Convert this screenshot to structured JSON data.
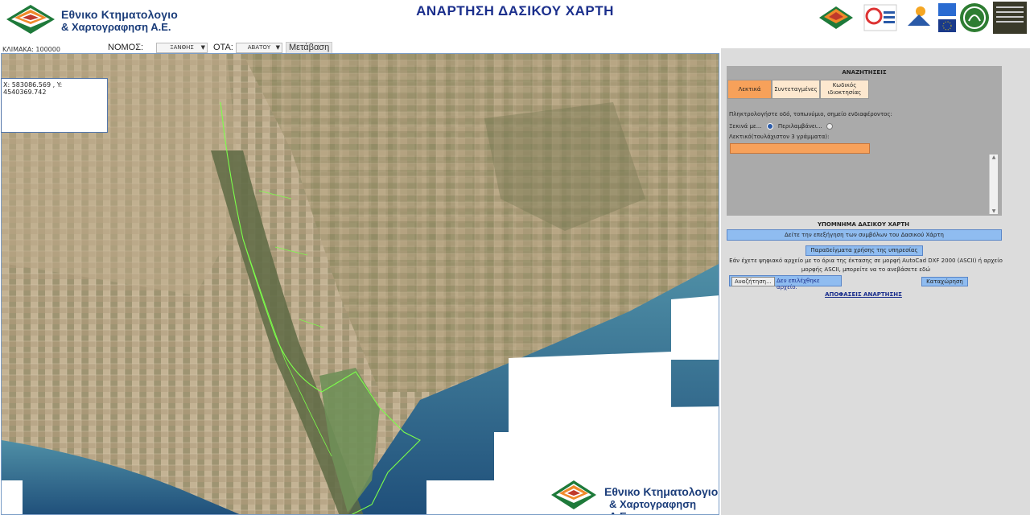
{
  "header": {
    "title": "ΑΝΑΡΤΗΣΗ ΔΑΣΙΚΟΥ ΧΑΡΤΗ",
    "org_line1": "Εθνικο Κτηματολογιο",
    "org_line2": "& Χαρτογραφηση Α.Ε."
  },
  "controls": {
    "scale": "ΚΛΙΜΑΚΑ: 100000",
    "nomos_label": "ΝΟΜΟΣ:",
    "nomos_value": "ΞΑΝΘΗΣ",
    "ota_label": "ΟΤΑ:",
    "ota_value": "ΑΒΑΤΟΥ",
    "go_label": "Μετάβαση"
  },
  "toolbar": {
    "tools": [
      "zoom-in-icon",
      "zoom-out-icon",
      "pan-icon",
      "zoom-box-icon",
      "zoom-extent-icon",
      "user-icon",
      "globe-icon",
      "measure-line-icon",
      "measure-area-icon",
      "polygon-icon",
      "polygon-select-icon",
      "select-arrow-icon",
      "delete-icon",
      "vertex-icon",
      "refresh-icon",
      "xy-icon",
      "xy-go-icon",
      "layers-icon",
      "info-icon",
      "tree-icon",
      "tree-green-icon",
      "brush-icon"
    ]
  },
  "map": {
    "coords": "X: 583086.569 , Y: 4540369.742",
    "logo_line1": "Εθνικο Κτηματολογιο",
    "logo_line2": "& Χαρτογραφηση Α.Ε."
  },
  "panel": {
    "search_title": "ΑΝΑΖΗΤΗΣΕΙΣ",
    "tabs": [
      "Λεκτικά",
      "Συντεταγμένες",
      "Κωδικός ιδιοκτησίας"
    ],
    "hint": "Πληκτρολογήστε οδό, τοπωνύμιο, σημείο ενδιαφέροντος:",
    "starts_with": "Ξεκινά με...",
    "contains": "Περιλαμβάνει...",
    "text_label": "Λεκτικό(τουλάχιστον 3 γράμματα):",
    "legend_title": "ΥΠΟΜΝΗΜΑ ΔΑΣΙΚΟΥ ΧΑΡΤΗ",
    "legend_link": "Δείτε την επεξήγηση των συμβόλων του Δασικού Χάρτη",
    "examples_btn": "Παραδείγματα χρήσης της υπηρεσίας",
    "dxf_note": "Εάν έχετε ψηφιακό αρχείο με το όρια της έκτασης σε μορφή AutoCad DXF 2000 (ASCII) ή αρχείο μορφής ASCII, μπορείτε να το ανεβάσετε εδώ",
    "browse_btn": "Αναζήτηση...",
    "no_file": "Δεν επιλέχθηκε αρχείο.",
    "register_btn": "Καταχώρηση",
    "decisions_link": "ΑΠΟΦΑΣΕΙΣ ΑΝΑΡΤΗΣΗΣ"
  },
  "colors": {
    "title_blue": "#1b2f8c",
    "tab_active": "#f7a15a",
    "button_blue": "#8fbcf0",
    "forest_outline": "#7cff4a"
  }
}
